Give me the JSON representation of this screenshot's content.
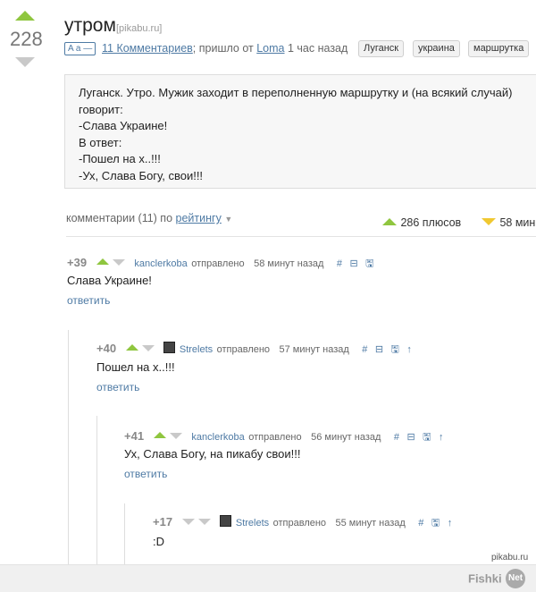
{
  "post": {
    "rating": "228",
    "title": "утром",
    "source": "[pikabu.ru]",
    "aa_label": "A a —",
    "comments_link": "11 Комментариев",
    "posted_prefix": "; пришло от",
    "author": "Loma",
    "time": "1 час назад",
    "tags": [
      "Луганск",
      "украина",
      "маршрутка"
    ],
    "story_lines": [
      "Луганск. Утро. Мужик заходит в переполненную маршрутку и (на всякий случай)",
      "говорит:",
      "-Слава Украине!",
      "В ответ:",
      "-Пошел на х..!!!",
      "-Ух, Слава Богу, свои!!!"
    ]
  },
  "comments_bar": {
    "label": "комментарии (11) по",
    "sort": "рейтингу",
    "pluses": "286 плюсов",
    "minuses": "58 мин"
  },
  "comments": [
    {
      "score": "+39",
      "author": "kanclerkoba",
      "verb": "отправлено",
      "time": "58 минут назад",
      "text": "Слава Украине!",
      "reply": "ответить"
    },
    {
      "score": "+40",
      "author": "Strelets",
      "verb": "отправлено",
      "time": "57 минут назад",
      "text": "Пошел на х..!!!",
      "reply": "ответить"
    },
    {
      "score": "+41",
      "author": "kanclerkoba",
      "verb": "отправлено",
      "time": "56 минут назад",
      "text": "Ух, Слава Богу, на пикабу свои!!!",
      "reply": "ответить"
    },
    {
      "score": "+17",
      "author": "Strelets",
      "verb": "отправлено",
      "time": "55 минут назад",
      "text": ":D",
      "reply": ""
    }
  ],
  "icons": {
    "hash": "#",
    "collapse": "⊟",
    "save": "🖫",
    "parent": "↑"
  },
  "watermark": {
    "site": "pikabu.ru",
    "fishki": "Fishki",
    "net": "Net"
  }
}
